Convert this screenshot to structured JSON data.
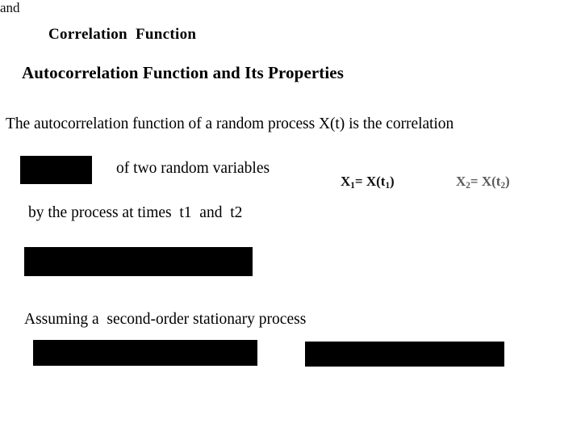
{
  "slide": {
    "background_color": "#ffffff",
    "text_color": "#000000",
    "heading_1": "Correlation  Function",
    "heading_2": "Autocorrelation Function and Its Properties",
    "line_1": "The autocorrelation function of a random process X(t) is the correlation",
    "line_2": "of two random variables",
    "line_3": "by the process at times  t1  and  t2",
    "line_4": "Assuming a  second-order stationary process",
    "math": {
      "expr_1_var": "X",
      "expr_1_sub": "1",
      "expr_1_eq": "= X(t",
      "expr_1_sub2": "1",
      "expr_1_close": ")",
      "conjunction": "and",
      "expr_2_var": "X",
      "expr_2_sub": "2",
      "expr_2_eq": "= X(t",
      "expr_2_sub2": "2",
      "expr_2_close": ")",
      "color_1": "#0d0d0d",
      "color_2": "#5a5a5a"
    },
    "redactions": [
      {
        "name": "redaction-box-1",
        "color": "#000000"
      },
      {
        "name": "redaction-box-2",
        "color": "#000000"
      },
      {
        "name": "redaction-box-3",
        "color": "#000000"
      },
      {
        "name": "redaction-box-4",
        "color": "#000000"
      }
    ]
  }
}
